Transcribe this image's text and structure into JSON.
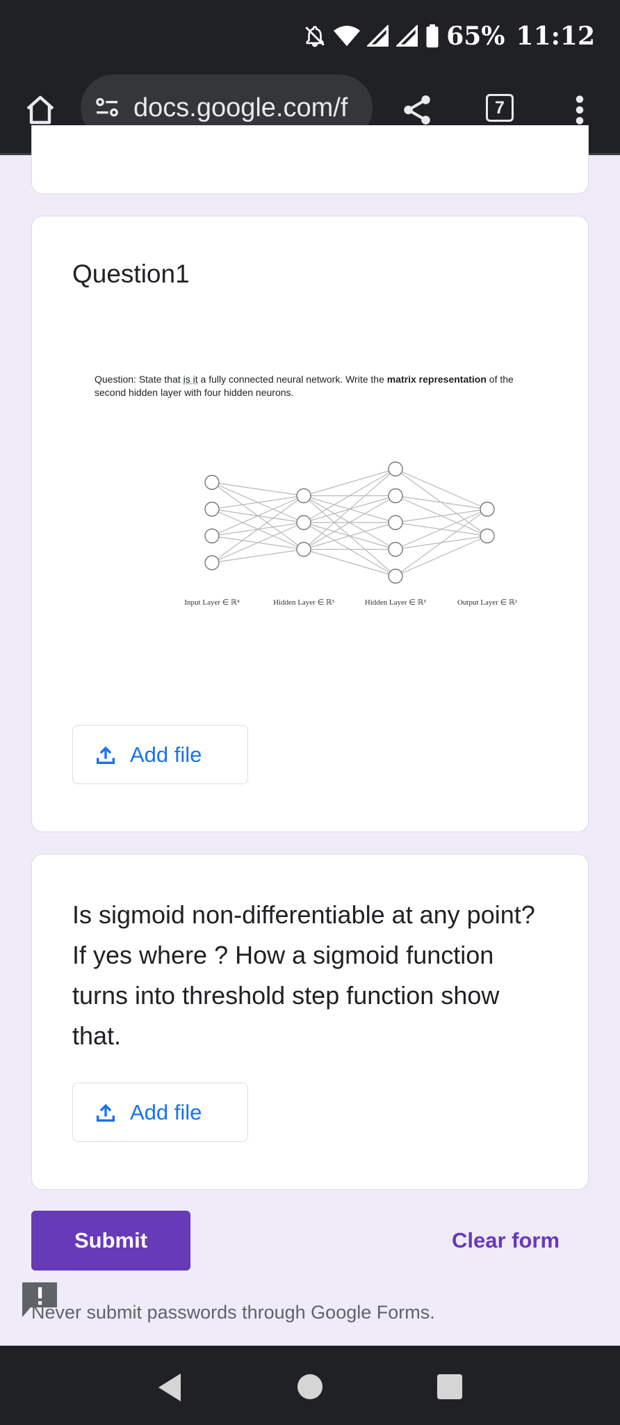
{
  "status_bar": {
    "battery": "65%",
    "time": "11:12",
    "icons": [
      "notifications-off-icon",
      "wifi-icon",
      "signal-icon",
      "signal-icon",
      "battery-icon"
    ]
  },
  "browser": {
    "url": "docs.google.com/f",
    "tab_count": "7",
    "icons": [
      "home-icon",
      "site-settings-icon",
      "share-icon",
      "tab-switcher-icon",
      "more-vert-icon"
    ]
  },
  "question1": {
    "title": "Question1",
    "image": {
      "text_plain": "Question: State that ",
      "text_underlined": "is it",
      "text_mid": " a fully connected neural network. Write the ",
      "text_bold": "matrix representation",
      "text_end": " of the second hidden layer with four hidden neurons.",
      "layer_labels": [
        "Input Layer ∈ ℝ⁴",
        "Hidden Layer ∈ ℝ³",
        "Hidden Layer ∈ ℝ⁵",
        "Output Layer ∈ ℝ²"
      ],
      "layer_sizes": [
        4,
        3,
        5,
        2
      ]
    },
    "add_file_label": "Add file"
  },
  "question2": {
    "text": "Is sigmoid non-differentiable at any point? If yes where ? How a sigmoid function turns into threshold step function show that.",
    "add_file_label": "Add file"
  },
  "actions": {
    "submit": "Submit",
    "clear": "Clear form"
  },
  "footer": {
    "note": "Never submit passwords through Google Forms."
  },
  "colors": {
    "accent": "#673ab7",
    "link": "#1a73e8",
    "background": "#efebf8"
  }
}
